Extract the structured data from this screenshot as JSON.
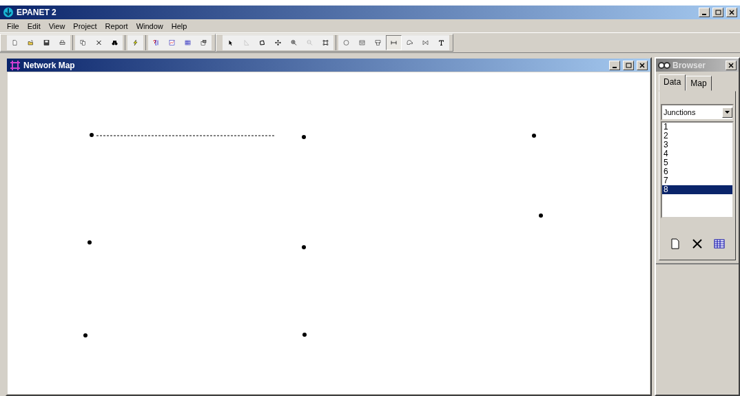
{
  "window": {
    "title": "EPANET 2"
  },
  "menu": [
    "File",
    "Edit",
    "View",
    "Project",
    "Report",
    "Window",
    "Help"
  ],
  "toolbar": {
    "groups": [
      [
        {
          "kind": "new",
          "selected": false
        },
        {
          "kind": "open",
          "selected": false
        },
        {
          "kind": "save",
          "selected": false
        },
        {
          "kind": "print",
          "selected": false
        }
      ],
      [
        {
          "kind": "copy",
          "selected": false
        },
        {
          "kind": "delete",
          "selected": false
        },
        {
          "kind": "find",
          "selected": false
        }
      ],
      [
        {
          "kind": "run",
          "selected": false
        }
      ],
      [
        {
          "kind": "query",
          "selected": false
        },
        {
          "kind": "graph",
          "selected": false
        },
        {
          "kind": "table",
          "selected": false
        },
        {
          "kind": "options",
          "selected": false
        }
      ]
    ],
    "map_tools": [
      {
        "kind": "select",
        "selected": false
      },
      {
        "kind": "vertex",
        "selected": false
      },
      {
        "kind": "region",
        "selected": false
      },
      {
        "kind": "pan",
        "selected": false
      },
      {
        "kind": "zoom-in",
        "selected": false
      },
      {
        "kind": "zoom-out",
        "selected": false
      },
      {
        "kind": "full",
        "selected": false
      },
      {
        "kind": "junction",
        "selected": false
      },
      {
        "kind": "reservoir",
        "selected": false
      },
      {
        "kind": "tank",
        "selected": false
      },
      {
        "kind": "pipe",
        "selected": true
      },
      {
        "kind": "pump",
        "selected": false
      },
      {
        "kind": "valve",
        "selected": false
      },
      {
        "kind": "label",
        "selected": false
      }
    ]
  },
  "map_window": {
    "title": "Network Map"
  },
  "browser": {
    "title": "Browser",
    "tabs": [
      {
        "label": "Data",
        "selected": true
      },
      {
        "label": "Map",
        "selected": false
      }
    ],
    "category": "Junctions",
    "items": [
      {
        "label": "1",
        "selected": false
      },
      {
        "label": "2",
        "selected": false
      },
      {
        "label": "3",
        "selected": false
      },
      {
        "label": "4",
        "selected": false
      },
      {
        "label": "5",
        "selected": false
      },
      {
        "label": "6",
        "selected": false
      },
      {
        "label": "7",
        "selected": false
      },
      {
        "label": "8",
        "selected": true
      }
    ]
  }
}
